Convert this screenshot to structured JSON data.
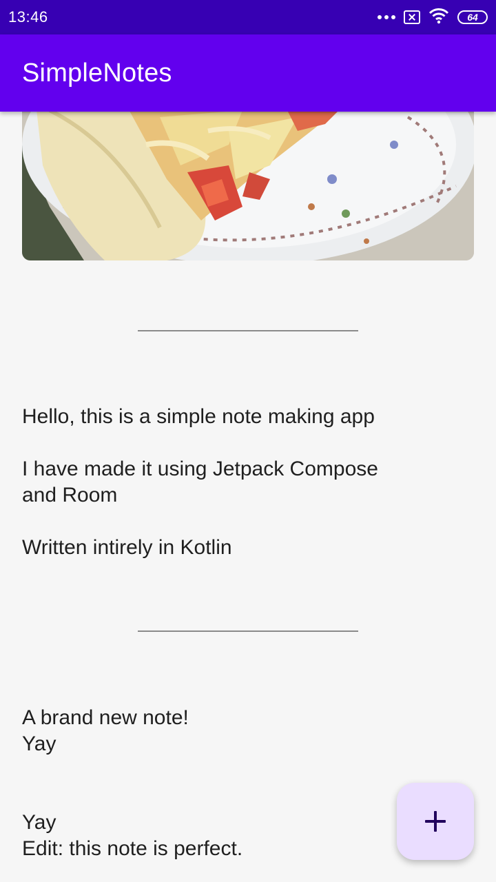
{
  "status_bar": {
    "time": "13:46",
    "icons": [
      "more-dots-icon",
      "sim-icon",
      "wifi-icon",
      "battery-icon"
    ],
    "battery_level": "64"
  },
  "app_bar": {
    "title": "SimpleNotes",
    "color": "#6200ee"
  },
  "notes": [
    {
      "type": "image",
      "icon": "food-photo-image"
    },
    {
      "type": "text",
      "text": "Hello, this is a simple note making app\n\nI have made it using Jetpack Compose\nand Room\n\nWritten intirely in Kotlin"
    },
    {
      "type": "text",
      "text": "A brand new note!\nYay\n\n\nYay\nEdit: this note is perfect."
    }
  ],
  "fab": {
    "icon": "plus-icon",
    "color": "#eaddff"
  }
}
